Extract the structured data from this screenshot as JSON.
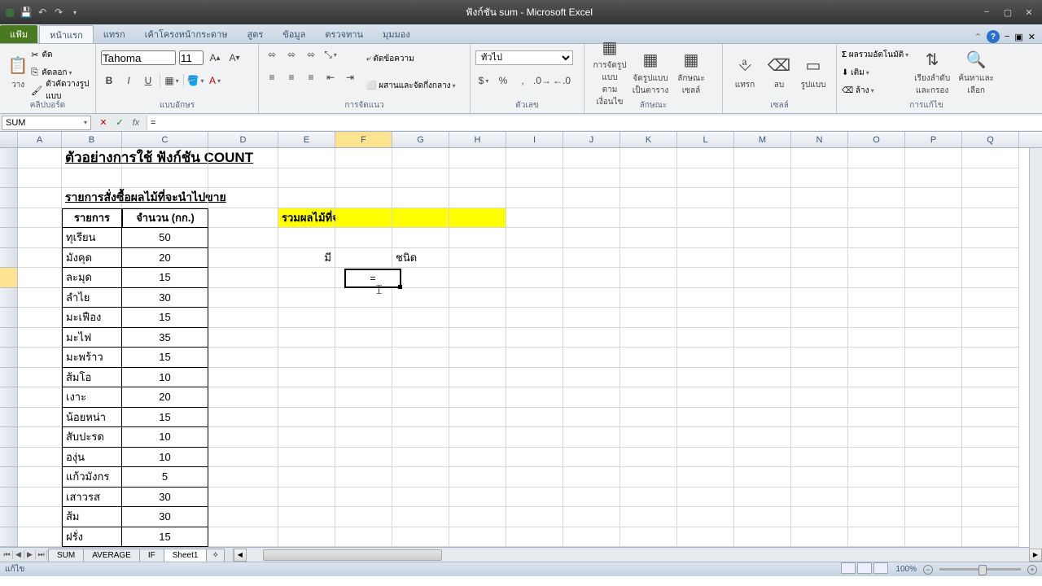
{
  "app": {
    "title": "ฟังก์ชัน sum - Microsoft Excel"
  },
  "tabs": {
    "file": "แฟ้ม",
    "home": "หน้าแรก",
    "insert": "แทรก",
    "pagelayout": "เค้าโครงหน้ากระดาษ",
    "formulas": "สูตร",
    "data": "ข้อมูล",
    "review": "ตรวจทาน",
    "view": "มุมมอง"
  },
  "ribbon": {
    "clipboard": {
      "label": "คลิปบอร์ด",
      "cut": "ตัด",
      "copy": "คัดลอก",
      "paste": "วาง",
      "formatpainter": "ตัวคัดวางรูปแบบ"
    },
    "font": {
      "label": "แบบอักษร",
      "name": "Tahoma",
      "size": "11"
    },
    "alignment": {
      "label": "การจัดแนว",
      "merge": "ผสานและจัดกึ่งกลาง",
      "wrap": "ตัดข้อความ"
    },
    "number": {
      "label": "ตัวเลข",
      "format": "ทั่วไป"
    },
    "styles": {
      "label": "ลักษณะ",
      "cond": "การจัดรูปแบบ\nตามเงื่อนไข",
      "table": "จัดรูปแบบ\nเป็นตาราง",
      "cell": "ลักษณะ\nเซลล์"
    },
    "cells": {
      "label": "เซลล์",
      "insert": "แทรก",
      "delete": "ลบ",
      "format": "รูปแบบ"
    },
    "editing": {
      "label": "การแก้ไข",
      "autosum": "ผลรวมอัตโนมัติ",
      "fill": "เติม",
      "clear": "ล้าง",
      "sort": "เรียงลำดับ\nและกรอง",
      "find": "ค้นหาและ\nเลือก"
    }
  },
  "formula_bar": {
    "name_box": "SUM",
    "formula": "="
  },
  "cols": [
    "A",
    "B",
    "C",
    "D",
    "E",
    "F",
    "G",
    "H",
    "I",
    "J",
    "K",
    "L",
    "M",
    "N",
    "O",
    "P",
    "Q"
  ],
  "active_col": "F",
  "content": {
    "title": "ตัวอย่างการใช้ ฟังก์ชัน COUNT",
    "subtitle": "รายการสั่งซื้อผลไม้ที่จะนำไปขาย",
    "header_item": "รายการ",
    "header_qty": "จำนวน (กก.)",
    "question": "รวมผลไม้ที่จะนำไปขายทั้งหมดมีกี่ชนิด",
    "mi": "มี",
    "chanit": "ชนิด",
    "cell_value": "=",
    "items": [
      {
        "name": "ทุเรียน",
        "qty": "50"
      },
      {
        "name": "มังคุด",
        "qty": "20"
      },
      {
        "name": "ละมุด",
        "qty": "15"
      },
      {
        "name": "ลำไย",
        "qty": "30"
      },
      {
        "name": "มะเฟือง",
        "qty": "15"
      },
      {
        "name": "มะไฟ",
        "qty": "35"
      },
      {
        "name": "มะพร้าว",
        "qty": "15"
      },
      {
        "name": "ส้มโอ",
        "qty": "10"
      },
      {
        "name": "เงาะ",
        "qty": "20"
      },
      {
        "name": "น้อยหน่า",
        "qty": "15"
      },
      {
        "name": "สับปะรด",
        "qty": "10"
      },
      {
        "name": "องุ่น",
        "qty": "10"
      },
      {
        "name": "แก้วมังกร",
        "qty": "5"
      },
      {
        "name": "เสาวรส",
        "qty": "30"
      },
      {
        "name": "ส้ม",
        "qty": "30"
      },
      {
        "name": "ฝรั่ง",
        "qty": "15"
      }
    ]
  },
  "sheets": {
    "tabs": [
      "SUM",
      "AVERAGE",
      "IF",
      "Sheet1"
    ],
    "active": "Sheet1"
  },
  "status": {
    "mode": "แก้ไข",
    "zoom": "100%"
  }
}
